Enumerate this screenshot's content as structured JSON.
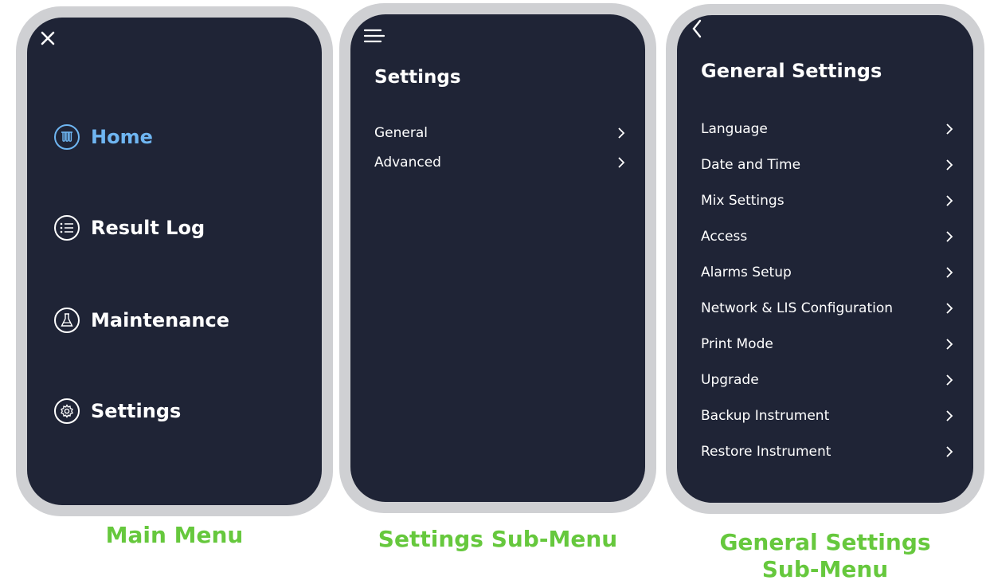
{
  "main_menu": {
    "caption": "Main Menu",
    "close_icon": "close-icon",
    "items": [
      {
        "label": "Home",
        "icon": "test-tubes-icon",
        "active": true
      },
      {
        "label": "Result Log",
        "icon": "list-icon",
        "active": false
      },
      {
        "label": "Maintenance",
        "icon": "flask-icon",
        "active": false
      },
      {
        "label": "Settings",
        "icon": "gear-icon",
        "active": false
      }
    ]
  },
  "settings_menu": {
    "caption": "Settings Sub-Menu",
    "title": "Settings",
    "items": [
      {
        "label": "General"
      },
      {
        "label": "Advanced"
      }
    ]
  },
  "general_settings_menu": {
    "caption_line1": "General Settings",
    "caption_line2": "Sub-Menu",
    "title": "General Settings",
    "items": [
      {
        "label": "Language"
      },
      {
        "label": "Date and Time"
      },
      {
        "label": "Mix Settings"
      },
      {
        "label": "Access"
      },
      {
        "label": "Alarms Setup"
      },
      {
        "label": "Network & LIS Configuration"
      },
      {
        "label": "Print Mode"
      },
      {
        "label": "Upgrade"
      },
      {
        "label": "Backup Instrument"
      },
      {
        "label": "Restore Instrument"
      }
    ]
  },
  "colors": {
    "screen_bg": "#1f2436",
    "bezel": "#cfd0d3",
    "active": "#6fb6f2",
    "caption": "#66c83d"
  }
}
